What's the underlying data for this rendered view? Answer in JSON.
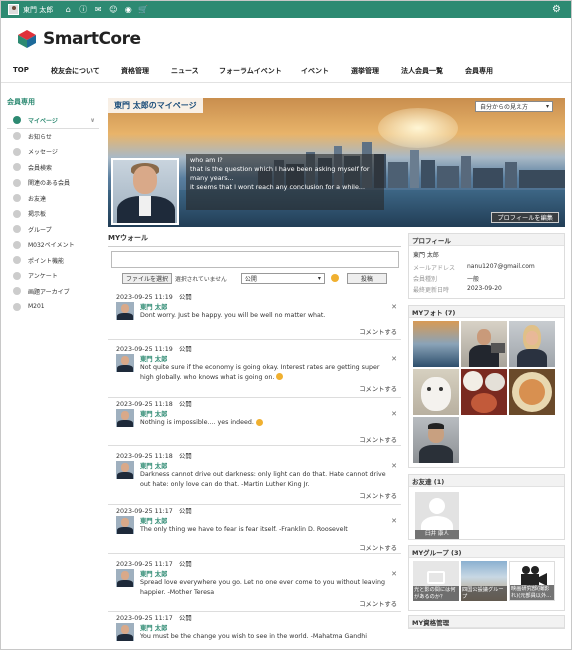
{
  "topbar": {
    "user_name": "東門 太郎",
    "bg_color": "#2d8a72"
  },
  "logo": {
    "text": "SmartCore"
  },
  "mainnav": [
    "TOP",
    "校友会について",
    "資格管理",
    "ニュース",
    "フォーラムイベント",
    "イベント",
    "選挙管理",
    "法人会員一覧",
    "会員専用"
  ],
  "sidebar": {
    "heading": "会員専用",
    "items": [
      {
        "label": "マイページ",
        "icon": "user-icon",
        "active": true
      },
      {
        "label": "お知らせ",
        "icon": "info-icon"
      },
      {
        "label": "メッセージ",
        "icon": "mail-icon"
      },
      {
        "label": "会員検索",
        "icon": "members-icon"
      },
      {
        "label": "関連のある会員",
        "icon": "link-icon"
      },
      {
        "label": "お友達",
        "icon": "friends-icon"
      },
      {
        "label": "掲示板",
        "icon": "board-icon"
      },
      {
        "label": "グループ",
        "icon": "group-icon"
      },
      {
        "label": "M032ペイメント",
        "icon": "payment-icon"
      },
      {
        "label": "ポイント機能",
        "icon": "point-icon"
      },
      {
        "label": "アンケート",
        "icon": "survey-icon"
      },
      {
        "label": "画題アーカイブ",
        "icon": "archive-icon"
      },
      {
        "label": "M201",
        "icon": "doc-icon"
      }
    ]
  },
  "hero": {
    "title": "東門 太郎のマイページ",
    "view_select": "自分からの見え方",
    "bubble_lines": [
      "who am I?",
      "that is the question which I have been asking myself for many years...",
      "it seems that I wont reach any conclusion for a while..."
    ],
    "profile_button": "プロフィールを編集"
  },
  "wall": {
    "title": "MYウォール",
    "file_button": "ファイルを選択",
    "no_file": "選択されていません",
    "visibility": "公開",
    "post_button": "投稿",
    "comment_label": "コメントする",
    "entries": [
      {
        "meta": "2023-09-25 11:19　公開",
        "name": "東門 太郎",
        "body": "Dont worry. Just be happy. you will be well no matter what."
      },
      {
        "meta": "2023-09-25 11:19　公開",
        "name": "東門 太郎",
        "body": "Not quite sure if the economy is going okay. Interest rates are getting super high globally. who knows what is going on."
      },
      {
        "meta": "2023-09-25 11:18　公開",
        "name": "東門 太郎",
        "body": "Nothing is impossible.... yes indeed."
      },
      {
        "meta": "2023-09-25 11:18　公開",
        "name": "東門 太郎",
        "body": "Darkness cannot drive out darkness: only light can do that. Hate cannot drive out hate: only love can do that. -Martin Luther King Jr."
      },
      {
        "meta": "2023-09-25 11:17　公開",
        "name": "東門 太郎",
        "body": "The only thing we have to fear is fear itself. -Franklin D. Roosevelt"
      },
      {
        "meta": "2023-09-25 11:17　公開",
        "name": "東門 太郎",
        "body": "Spread love everywhere you go. Let no one ever come to you without leaving happier. -Mother Teresa"
      },
      {
        "meta": "2023-09-25 11:17　公開",
        "name": "東門 太郎",
        "body": "You must be the change you wish to see in the world. -Mahatma Gandhi"
      }
    ]
  },
  "profile": {
    "title": "プロフィール",
    "name": "東門 太郎",
    "email_label": "メールアドレス",
    "email": "nanu1207@gmail.com",
    "type_label": "会員種別",
    "type": "一般",
    "updated_label": "最終更新日時",
    "updated": "2023-09-20"
  },
  "photos": {
    "title": "MYフォト (7)"
  },
  "friends": {
    "title": "お友達 (1)",
    "items": [
      {
        "name": "臼井 康人"
      }
    ]
  },
  "groups": {
    "title": "MYグループ (3)",
    "items": [
      {
        "label": "光と影の間には何があるのか？"
      },
      {
        "label": "四国公設議グループ"
      },
      {
        "label": "映画研究部(撮影れ)(元部員以外..."
      }
    ]
  },
  "certs": {
    "title": "MY資格管理"
  }
}
